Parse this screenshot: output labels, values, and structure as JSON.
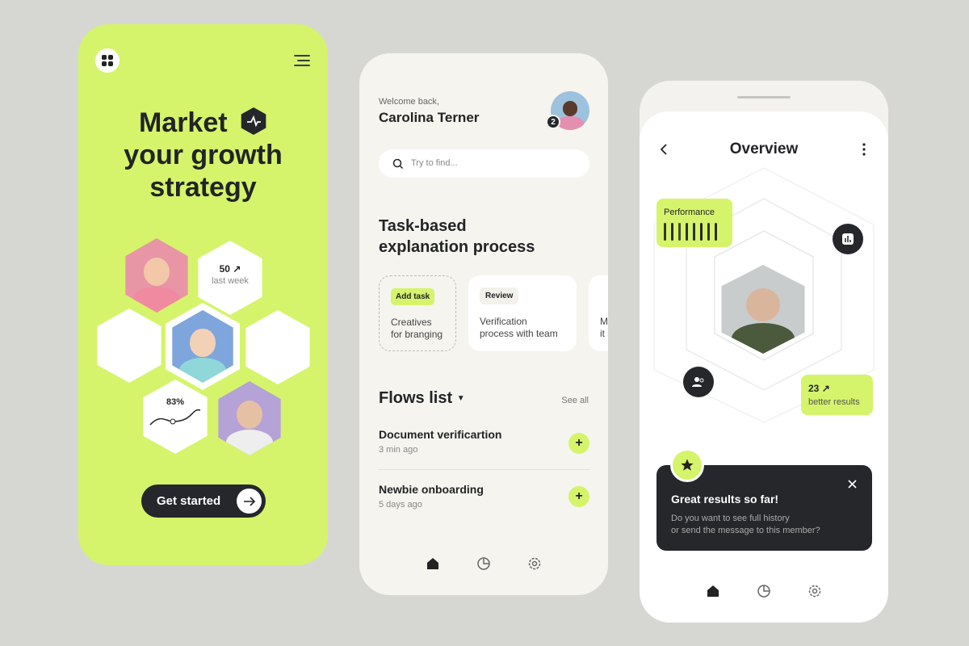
{
  "colors": {
    "accent": "#d5f46b",
    "dark": "#25272a",
    "background": "#d6d7d3"
  },
  "screen1": {
    "title_line1": "Market",
    "title_line2": "your growth",
    "title_line3": "strategy",
    "stat_value": "50",
    "stat_label": "last week",
    "stat_icon": "arrow-up-right-icon",
    "percent": "83%",
    "cta_label": "Get started"
  },
  "screen2": {
    "welcome": "Welcome back,",
    "user_name": "Carolina Terner",
    "notification_count": "2",
    "search_placeholder": "Try to find...",
    "section_title_line1": "Task-based",
    "section_title_line2": "explanation process",
    "tasks": [
      {
        "tag": "Add task",
        "line1": "Creatives",
        "line2": "for branging"
      },
      {
        "tag": "Review",
        "line1": "Verification",
        "line2": "process with team"
      },
      {
        "tag": "",
        "line1": "M",
        "line2": "it"
      }
    ],
    "flows_title": "Flows list",
    "see_all": "See all",
    "flows": [
      {
        "title": "Document verificartion",
        "time": "3 min ago"
      },
      {
        "title": "Newbie onboarding",
        "time": "5 days ago"
      }
    ]
  },
  "screen3": {
    "title": "Overview",
    "performance_label": "Performance",
    "performance_bars": [
      0.8,
      0.9,
      0.6,
      0.85,
      0.9,
      0.95,
      0.8,
      0.9
    ],
    "result_value": "23",
    "result_label": "better results",
    "toast_title": "Great results so far!",
    "toast_line1": "Do you want to see full history",
    "toast_line2": "or send the message to this member?"
  }
}
